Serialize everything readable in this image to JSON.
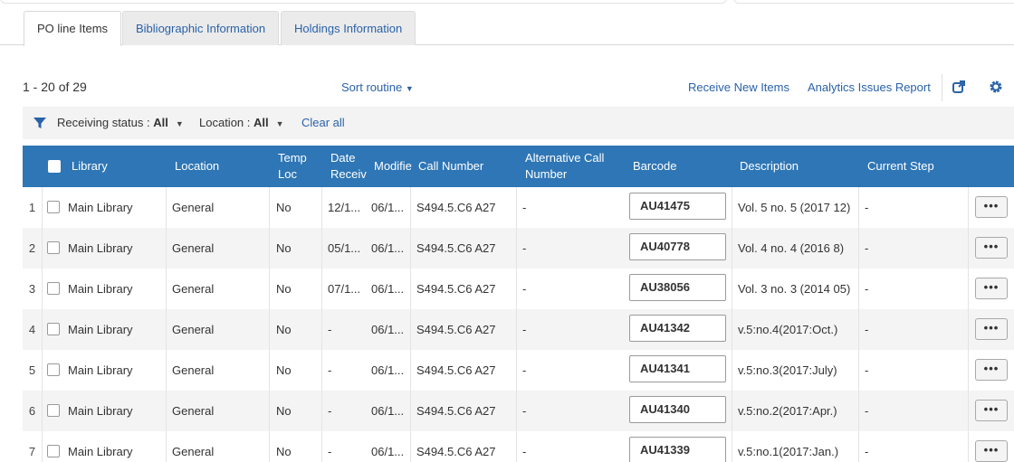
{
  "tabs": [
    {
      "label": "PO line Items",
      "active": true
    },
    {
      "label": "Bibliographic Information",
      "active": false
    },
    {
      "label": "Holdings Information",
      "active": false
    }
  ],
  "toolbar": {
    "count": "1 - 20 of 29",
    "sort_label": "Sort routine",
    "receive_new_items": "Receive New Items",
    "analytics_report": "Analytics Issues Report",
    "icons": [
      "external-link-icon",
      "gear-icon"
    ]
  },
  "filters": {
    "icon": "filter-icon",
    "receiving_status_label": "Receiving status : ",
    "receiving_status_value": "All",
    "location_label": "Location : ",
    "location_value": "All",
    "clear_all": "Clear all"
  },
  "columns": {
    "library": "Library",
    "location": "Location",
    "temp_loc": "Temp Loc",
    "date_received": "Date Receive",
    "modified": "Modifie",
    "call_number": "Call Number",
    "alt_call_number": "Alternative Call Number",
    "barcode": "Barcode",
    "description": "Description",
    "current_step": "Current Step"
  },
  "rows": [
    {
      "num": "1",
      "library": "Main Library",
      "location": "General",
      "temp_loc": "No",
      "date_received": "12/1...",
      "modified": "06/1...",
      "call_number": "S494.5.C6 A27",
      "alt_call_number": "-",
      "barcode": "AU41475",
      "description": "Vol. 5 no. 5 (2017 12)",
      "current_step": "-",
      "more": "•••"
    },
    {
      "num": "2",
      "library": "Main Library",
      "location": "General",
      "temp_loc": "No",
      "date_received": "05/1...",
      "modified": "06/1...",
      "call_number": "S494.5.C6 A27",
      "alt_call_number": "-",
      "barcode": "AU40778",
      "description": "Vol. 4 no. 4 (2016 8)",
      "current_step": "-",
      "more": "•••"
    },
    {
      "num": "3",
      "library": "Main Library",
      "location": "General",
      "temp_loc": "No",
      "date_received": "07/1...",
      "modified": "06/1...",
      "call_number": "S494.5.C6 A27",
      "alt_call_number": "-",
      "barcode": "AU38056",
      "description": "Vol. 3 no. 3 (2014 05)",
      "current_step": "-",
      "more": "•••"
    },
    {
      "num": "4",
      "library": "Main Library",
      "location": "General",
      "temp_loc": "No",
      "date_received": "-",
      "modified": "06/1...",
      "call_number": "S494.5.C6 A27",
      "alt_call_number": "-",
      "barcode": "AU41342",
      "description": "v.5:no.4(2017:Oct.)",
      "current_step": "-",
      "more": "•••"
    },
    {
      "num": "5",
      "library": "Main Library",
      "location": "General",
      "temp_loc": "No",
      "date_received": "-",
      "modified": "06/1...",
      "call_number": "S494.5.C6 A27",
      "alt_call_number": "-",
      "barcode": "AU41341",
      "description": "v.5:no.3(2017:July)",
      "current_step": "-",
      "more": "•••"
    },
    {
      "num": "6",
      "library": "Main Library",
      "location": "General",
      "temp_loc": "No",
      "date_received": "-",
      "modified": "06/1...",
      "call_number": "S494.5.C6 A27",
      "alt_call_number": "-",
      "barcode": "AU41340",
      "description": "v.5:no.2(2017:Apr.)",
      "current_step": "-",
      "more": "•••"
    },
    {
      "num": "7",
      "library": "Main Library",
      "location": "General",
      "temp_loc": "No",
      "date_received": "-",
      "modified": "06/1...",
      "call_number": "S494.5.C6 A27",
      "alt_call_number": "-",
      "barcode": "AU41339",
      "description": "v.5:no.1(2017:Jan.)",
      "current_step": "-",
      "more": "•••"
    }
  ],
  "colors": {
    "header": "#2e76b5",
    "link": "#2a62a8"
  }
}
